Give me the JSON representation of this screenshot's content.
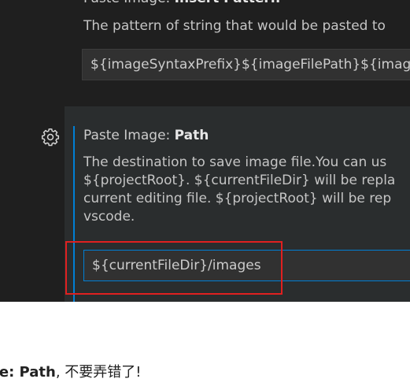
{
  "settings": {
    "insert_pattern": {
      "prefix": "Paste Image: ",
      "name": "Insert Pattern",
      "description": "The pattern of string that would be pasted to",
      "value": "${imageSyntaxPrefix}${imageFilePath}${imag"
    },
    "path": {
      "prefix": "Paste Image: ",
      "name": "Path",
      "description_lines": [
        "The destination to save image file.You can us",
        "${projectRoot}. ${currentFileDir} will be repla",
        "current editing file. ${projectRoot} will be rep",
        "vscode."
      ],
      "value": "${currentFileDir}/images"
    }
  },
  "icons": {
    "settings_gear": "gear-icon"
  },
  "colors": {
    "panel_bg": "#1f1f1f",
    "active_bg": "#2a2d2e",
    "focus_blue": "#007fd4",
    "highlight_red": "#e02020"
  },
  "caption": {
    "bold": "ge: Path",
    "rest": ", 不要弄错了!"
  }
}
